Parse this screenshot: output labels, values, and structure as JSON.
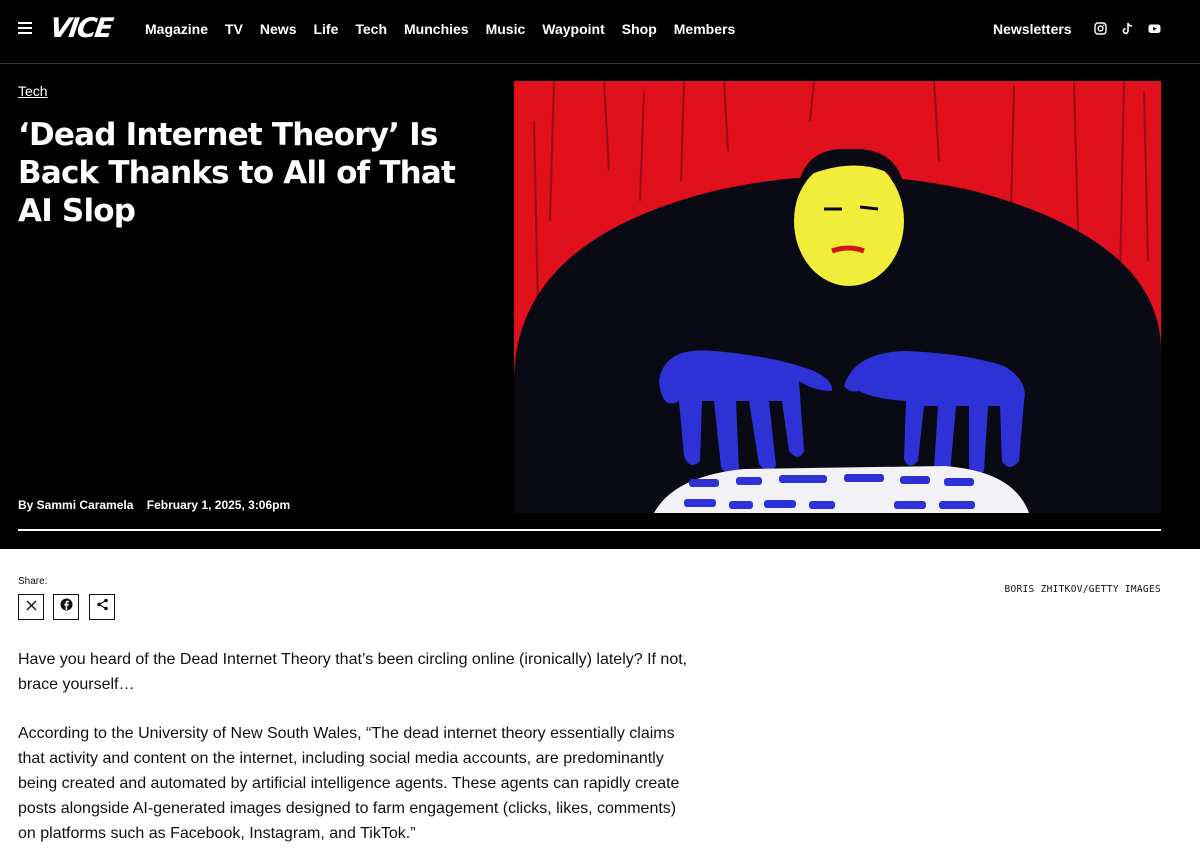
{
  "header": {
    "logo": "VICE",
    "nav_links": [
      "Magazine",
      "TV",
      "News",
      "Life",
      "Tech",
      "Munchies",
      "Music",
      "Waypoint",
      "Shop",
      "Members"
    ],
    "newsletters": "Newsletters",
    "social_icons": [
      "instagram-icon",
      "tiktok-icon",
      "youtube-icon"
    ]
  },
  "article": {
    "category": "Tech",
    "headline": "‘Dead Internet Theory’ Is Back Thanks to All of That AI Slop",
    "author": "By Sammi Caramela",
    "date": "February 1, 2025, 3:06pm",
    "share_label": "Share:",
    "share_buttons": [
      "x-icon",
      "facebook-icon",
      "share-icon"
    ],
    "image_credit": "BORIS ZHITKOV/GETTY IMAGES",
    "paragraphs": [
      "Have you heard of the Dead Internet Theory that’s been circling online (ironically) lately? If not, brace yourself…",
      "According to the University of New South Wales, “The dead internet theory essentially claims that activity and content on the internet, including social media accounts, are predominantly being created and automated by artificial intelligence agents. These agents can rapidly create posts alongside AI-generated images designed to farm engagement (clicks, likes, comments) on platforms such as Facebook, Instagram, and TikTok.”"
    ]
  },
  "colors": {
    "hero_background": "#000000",
    "illustration_red": "#e0101c",
    "illustration_yellow": "#f2ec3a",
    "illustration_blue": "#2e32d6"
  }
}
